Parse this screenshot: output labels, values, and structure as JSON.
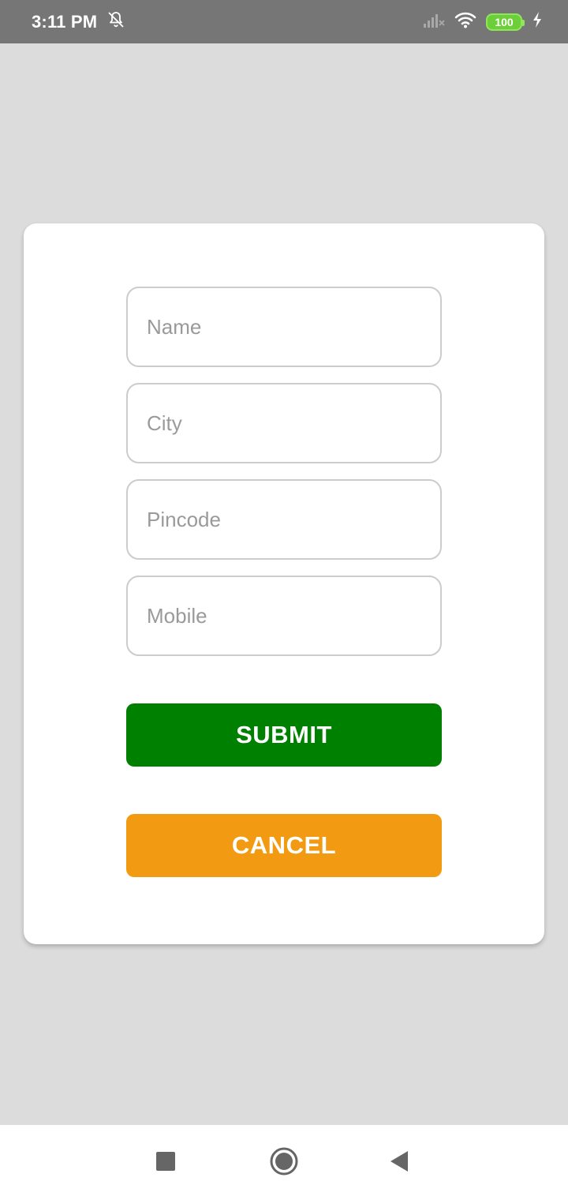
{
  "status_bar": {
    "time": "3:11 PM",
    "battery_level": "100",
    "icons": [
      "mute-bell-icon",
      "signal-icon",
      "wifi-icon",
      "battery-icon",
      "charging-icon"
    ]
  },
  "form": {
    "fields": [
      {
        "name": "name",
        "placeholder": "Name",
        "value": ""
      },
      {
        "name": "city",
        "placeholder": "City",
        "value": ""
      },
      {
        "name": "pincode",
        "placeholder": "Pincode",
        "value": ""
      },
      {
        "name": "mobile",
        "placeholder": "Mobile",
        "value": ""
      }
    ],
    "submit_label": "SUBMIT",
    "cancel_label": "CANCEL"
  },
  "colors": {
    "status_bar": "#767676",
    "background": "#dcdcdc",
    "submit": "#008000",
    "cancel": "#f29b12",
    "field_border": "#cccccc"
  },
  "nav_bar": {
    "icons": [
      "recents-icon",
      "home-icon",
      "back-icon"
    ]
  }
}
